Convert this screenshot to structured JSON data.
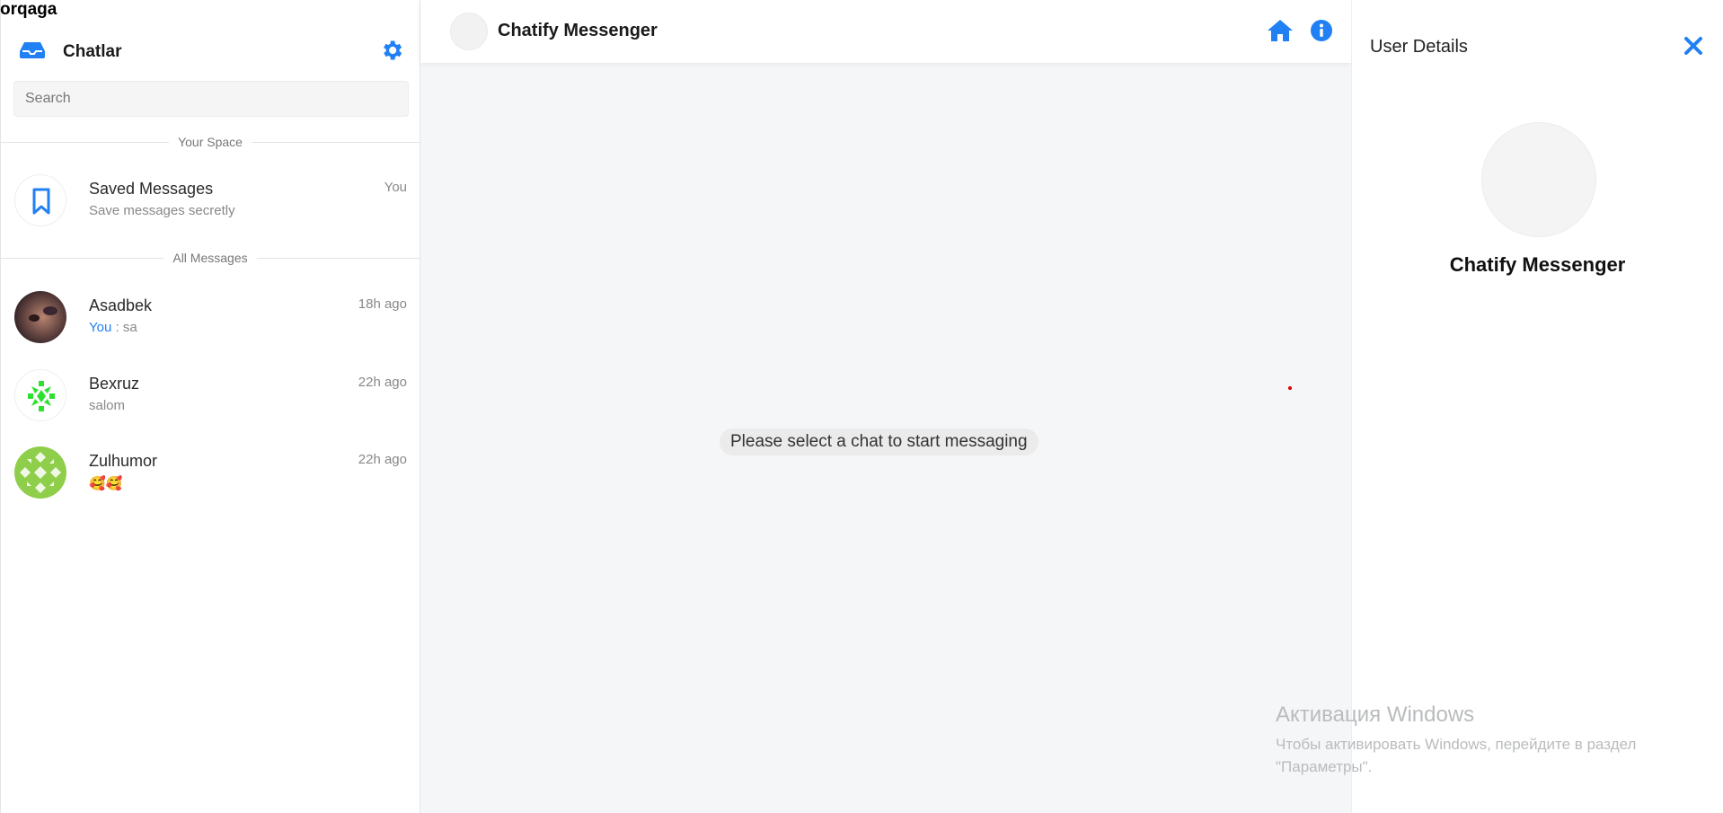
{
  "back_link": "orqaga",
  "sidebar": {
    "title": "Chatlar",
    "search_placeholder": "Search",
    "your_space_label": "Your Space",
    "all_messages_label": "All Messages",
    "saved": {
      "name": "Saved Messages",
      "preview": "Save messages secretly",
      "time": "You"
    },
    "chats": [
      {
        "name": "Asadbek",
        "time": "18h ago",
        "preview_prefix": "You",
        "preview": " : sa"
      },
      {
        "name": "Bexruz",
        "time": "22h ago",
        "preview": "salom"
      },
      {
        "name": "Zulhumor",
        "time": "22h ago",
        "preview": "🥰🥰"
      }
    ]
  },
  "main": {
    "title": "Chatify Messenger",
    "empty_message": "Please select a chat to start messaging"
  },
  "details": {
    "title": "User Details",
    "name": "Chatify Messenger"
  },
  "watermark": {
    "line1": "Активация Windows",
    "line2": "Чтобы активировать Windows, перейдите в раздел \"Параметры\"."
  },
  "colors": {
    "accent": "#2180f3",
    "bexruz_avatar": "#2ee02e",
    "zulhumor_avatar": "#8fce4a"
  }
}
